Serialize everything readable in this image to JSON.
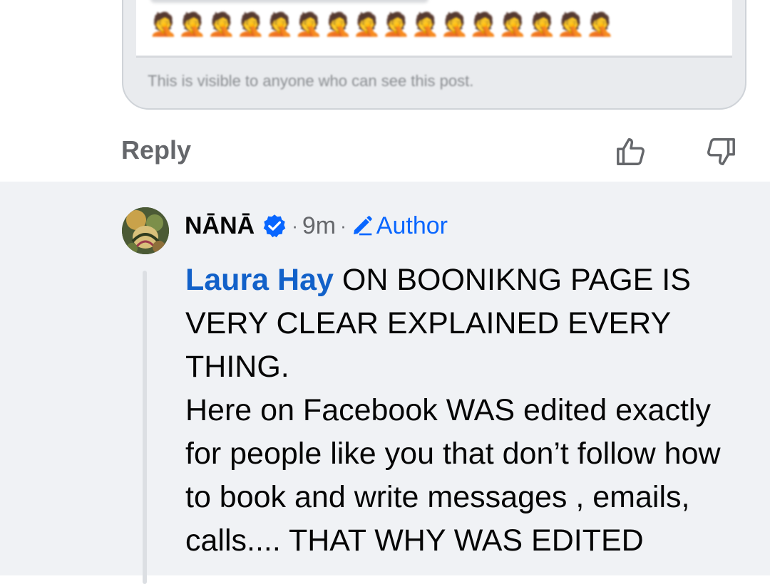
{
  "attachment": {
    "emojis": [
      "🤦",
      "🤦",
      "🤦",
      "🤦",
      "🤦",
      "🤦",
      "🤦",
      "🤦",
      "🤦",
      "🤦",
      "🤦",
      "🤦",
      "🤦",
      "🤦",
      "🤦",
      "🤦"
    ],
    "visibility_note": "This is visible to anyone who can see this post."
  },
  "actions": {
    "reply_label": "Reply",
    "like_icon": "thumbs-up-icon",
    "dislike_icon": "thumbs-down-icon"
  },
  "comment": {
    "author": "NĀNĀ",
    "verified_icon": "verified-badge-icon",
    "separator": "·",
    "time": "9m",
    "author_badge_icon": "pencil-icon",
    "author_badge": "Author",
    "mention": "Laura Hay",
    "text_line1": " ON BOONIKNG PAGE IS VERY CLEAR EXPLAINED EVERY THING.",
    "text_line2": "Here on Facebook WAS edited exactly for people like you that don’t follow how to book and write messages , emails, calls.... THAT WHY WAS EDITED"
  },
  "colors": {
    "link_blue": "#0866ff",
    "mention_blue": "#1261c9",
    "verified_blue": "#0866ff",
    "reply_bg": "#f0f2f5",
    "secondary_text": "#65676b"
  }
}
